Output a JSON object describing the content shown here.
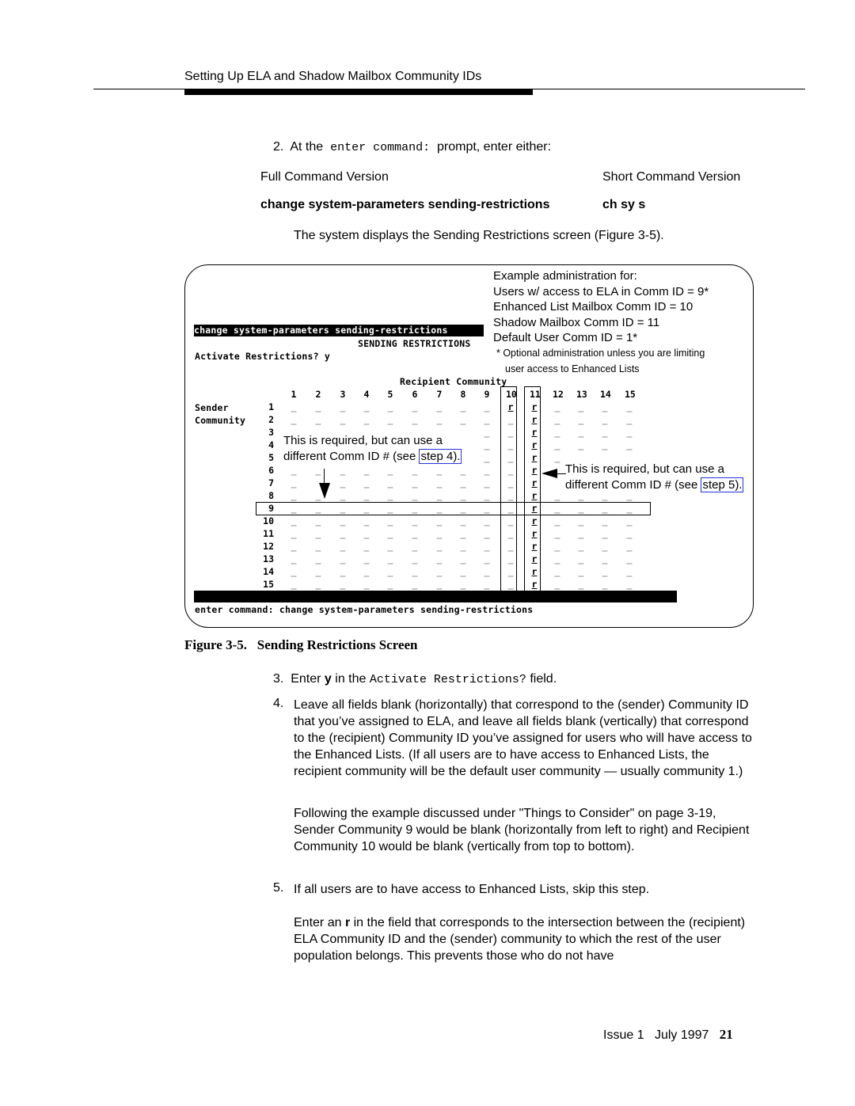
{
  "header": {
    "running_title": "Setting Up ELA and Shadow Mailbox Community IDs"
  },
  "step2": {
    "number": "2.",
    "text_before": "At the",
    "code": "enter command:",
    "text_after": "prompt, enter either:"
  },
  "commands": {
    "full_label": "Full Command Version",
    "short_label": "Short Command Version",
    "full": "change system-parameters sending-restrictions",
    "short": "ch sy s"
  },
  "displays_text": "The system displays the Sending Restrictions screen (Figure 3-5).",
  "figure": {
    "notes": [
      "Example administration for:",
      "Users w/ access to ELA in Comm ID = 9*",
      "Enhanced List Mailbox Comm ID = 10",
      "Shadow Mailbox Comm ID = 11",
      "Default User Comm ID = 1*"
    ],
    "footnote": [
      "* Optional administration unless you are limiting",
      "user access to Enhanced Lists"
    ],
    "screen": {
      "command_bar": "change system-parameters sending-restrictions",
      "screen_title": "SENDING RESTRICTIONS",
      "activate_label": "Activate Restrictions?",
      "activate_value": "y",
      "recipient_label": "Recipient Community",
      "sender_label": [
        "Sender",
        "Community"
      ],
      "columns": [
        "1",
        "2",
        "3",
        "4",
        "5",
        "6",
        "7",
        "8",
        "9",
        "10",
        "11",
        "12",
        "13",
        "14",
        "15"
      ],
      "rows": [
        "1",
        "2",
        "3",
        "4",
        "5",
        "6",
        "7",
        "8",
        "9",
        "10",
        "11",
        "12",
        "13",
        "14",
        "15"
      ],
      "cells": [
        [
          "_",
          "_",
          "_",
          "_",
          "_",
          "_",
          "_",
          "_",
          "_",
          "r",
          "r",
          "_",
          "_",
          "_",
          "_"
        ],
        [
          "_",
          "_",
          "_",
          "_",
          "_",
          "_",
          "_",
          "_",
          "_",
          "_",
          "r",
          "_",
          "_",
          "_",
          "_"
        ],
        [
          null,
          null,
          null,
          null,
          null,
          null,
          null,
          null,
          "_",
          "_",
          "r",
          "_",
          "_",
          "_",
          "_"
        ],
        [
          null,
          null,
          null,
          null,
          null,
          null,
          null,
          null,
          "_",
          "_",
          "r",
          "_",
          "_",
          "_",
          "_"
        ],
        [
          null,
          null,
          null,
          null,
          null,
          null,
          null,
          null,
          "_",
          "_",
          "r",
          "_",
          "_",
          "_",
          "_"
        ],
        [
          "_",
          "_",
          "_",
          "_",
          "_",
          "_",
          "_",
          "_",
          "_",
          "_",
          "r",
          null,
          null,
          null,
          null
        ],
        [
          "_",
          null,
          "_",
          "_",
          "_",
          "_",
          "_",
          "_",
          "_",
          "_",
          "r",
          null,
          null,
          null,
          null
        ],
        [
          "_",
          "_",
          "_",
          "_",
          "_",
          "_",
          "_",
          "_",
          "_",
          "_",
          "r",
          "_",
          "_",
          "_",
          "_"
        ],
        [
          "_",
          "_",
          "_",
          "_",
          "_",
          "_",
          "_",
          "_",
          "_",
          "_",
          "r",
          "_",
          "_",
          "_",
          "_"
        ],
        [
          "_",
          "_",
          "_",
          "_",
          "_",
          "_",
          "_",
          "_",
          "_",
          "_",
          "r",
          "_",
          "_",
          "_",
          "_"
        ],
        [
          "_",
          "_",
          "_",
          "_",
          "_",
          "_",
          "_",
          "_",
          "_",
          "_",
          "r",
          "_",
          "_",
          "_",
          "_"
        ],
        [
          "_",
          "_",
          "_",
          "_",
          "_",
          "_",
          "_",
          "_",
          "_",
          "_",
          "r",
          "_",
          "_",
          "_",
          "_"
        ],
        [
          "_",
          "_",
          "_",
          "_",
          "_",
          "_",
          "_",
          "_",
          "_",
          "_",
          "r",
          "_",
          "_",
          "_",
          "_"
        ],
        [
          "_",
          "_",
          "_",
          "_",
          "_",
          "_",
          "_",
          "_",
          "_",
          "_",
          "r",
          "_",
          "_",
          "_",
          "_"
        ],
        [
          "_",
          "_",
          "_",
          "_",
          "_",
          "_",
          "_",
          "_",
          "_",
          "_",
          "r",
          "_",
          "_",
          "_",
          "_"
        ]
      ],
      "enter_command": "enter command: change system-parameters sending-restrictions"
    },
    "callout_left": {
      "line1": "This is required, but can use a",
      "line2_before": "different Comm ID # (see ",
      "link": "step 4)."
    },
    "callout_right": {
      "line1": "This is required, but can use a",
      "line2_before": "different Comm ID # (see ",
      "link": "step 5)."
    },
    "caption_number": "Figure 3-5.",
    "caption_title": "Sending Restrictions Screen"
  },
  "step3": {
    "number": "3.",
    "before": "Enter ",
    "bold": "y",
    "middle": " in the ",
    "code": "Activate Restrictions?",
    "after": " field."
  },
  "step4": {
    "number": "4.",
    "text": "Leave all fields blank (horizontally) that correspond to the (sender) Community ID that you’ve assigned to ELA, and leave all fields blank (vertically) that correspond to the (recipient) Community ID you’ve assigned for users who will have access to the Enhanced Lists. (If all users are to have access to Enhanced Lists, the recipient community will be the default user community — usually community 1.)",
    "para2": "Following the example discussed under \"Things to Consider\" on page 3-19, Sender Community 9 would be blank (horizontally from left to right) and Recipient Community 10 would be blank (vertically from top to bottom)."
  },
  "step5": {
    "number": "5.",
    "text": "If all users are to have access to Enhanced Lists, skip this step.",
    "para2_before": "Enter an ",
    "para2_bold": "r",
    "para2_after": " in the field that corresponds to the intersection between the (recipient) ELA Community ID and the (sender) community to which the rest of the user population belongs. This prevents those who do not have"
  },
  "footer": {
    "issue": "Issue 1",
    "date": "July 1997",
    "page": "21"
  }
}
